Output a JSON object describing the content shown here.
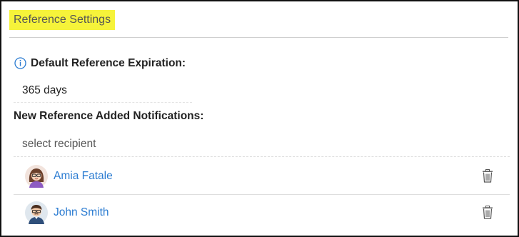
{
  "section": {
    "title": "Reference Settings"
  },
  "expiration": {
    "label": "Default Reference Expiration:",
    "value": "365 days",
    "icon": "info-icon"
  },
  "notifications": {
    "label": "New Reference Added Notifications:",
    "recipient_placeholder": "select recipient",
    "recipients": [
      {
        "name": "Amia Fatale",
        "avatar": "female-avatar",
        "action_icon": "trash-icon"
      },
      {
        "name": "John Smith",
        "avatar": "male-avatar",
        "action_icon": "trash-icon"
      }
    ]
  },
  "colors": {
    "highlight": "#f6f33a",
    "link": "#2a7bd1",
    "info_icon": "#2a7bd1"
  }
}
